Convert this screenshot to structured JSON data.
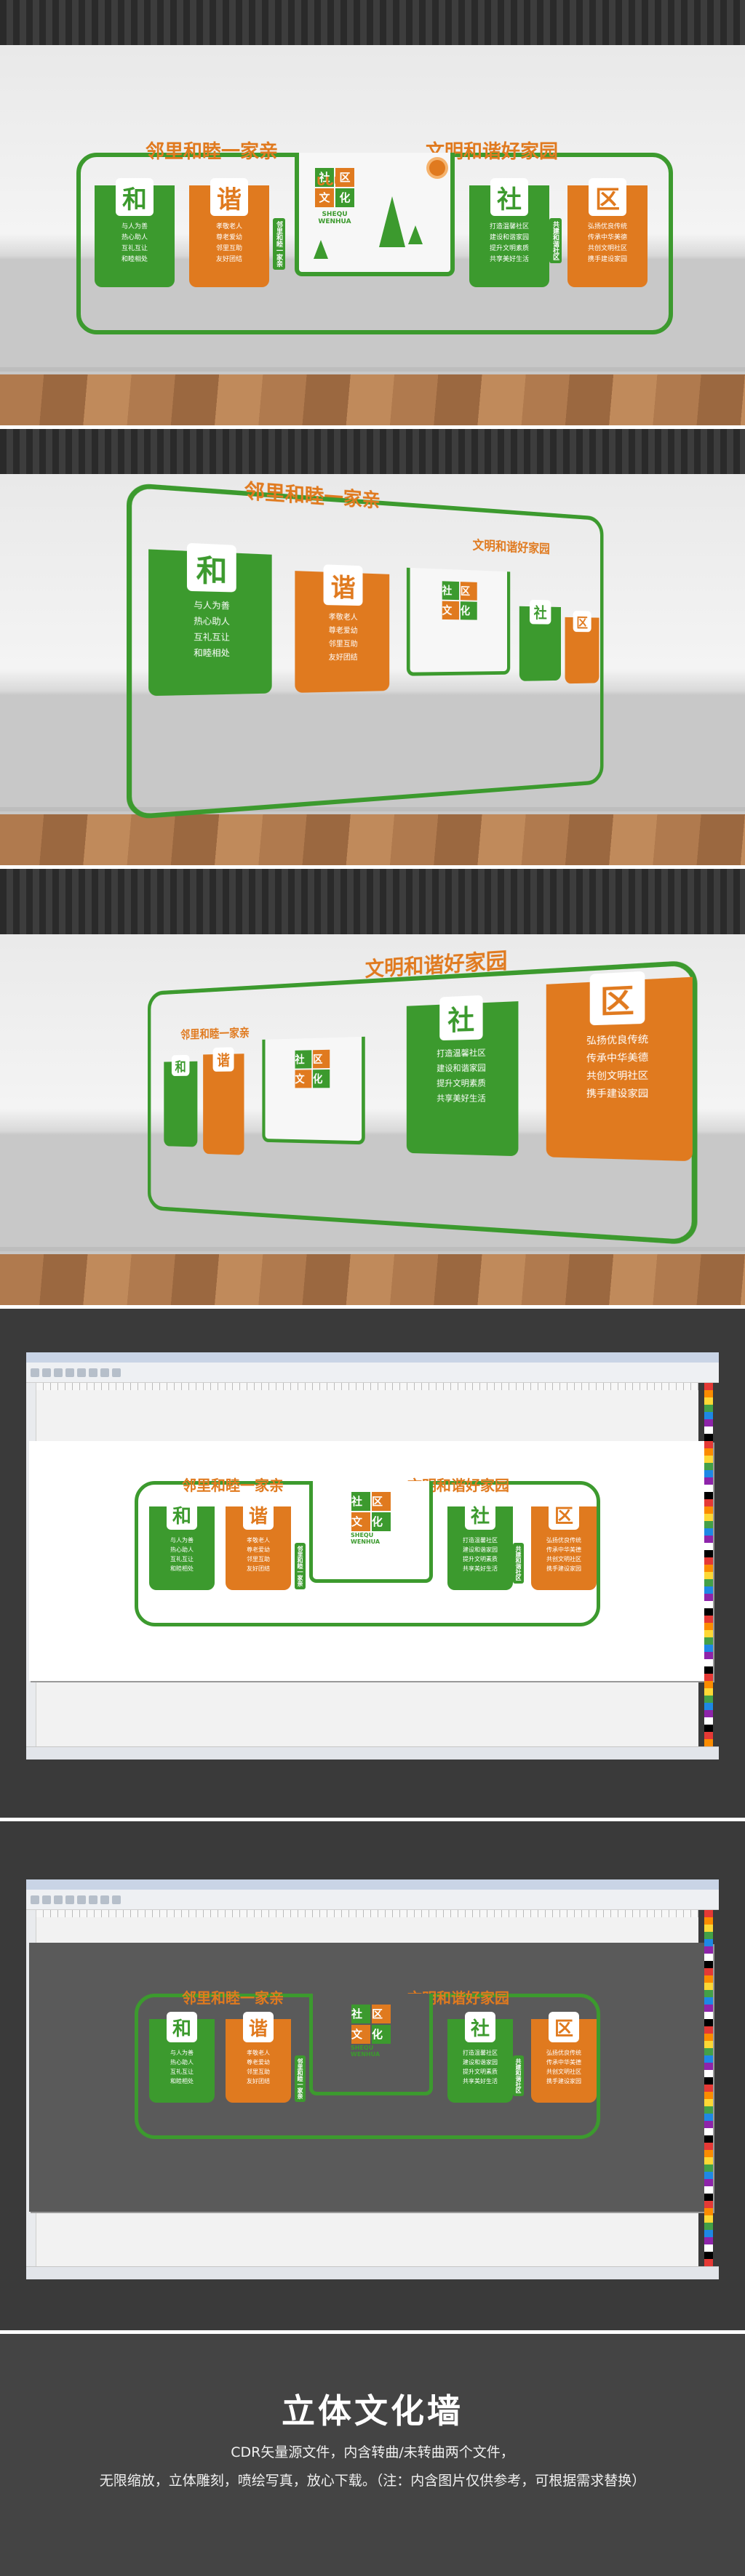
{
  "headline_left": "邻里和睦一家亲",
  "headline_right": "文明和谐好家园",
  "house_chars": [
    "和",
    "谐",
    "社",
    "区"
  ],
  "left_text_1": [
    "与人为善",
    "热心助人",
    "互礼互让",
    "和睦相处"
  ],
  "left_text_2": [
    "孝敬老人",
    "尊老爱幼",
    "邻里互助",
    "友好团结"
  ],
  "right_text_1": [
    "打造温馨社区",
    "建设和谐家园",
    "提升文明素质",
    "共享美好生活"
  ],
  "right_text_2": [
    "弘扬优良传统",
    "传承中华美德",
    "共创文明社区",
    "携手建设家园"
  ],
  "strip_left": "邻里和睦一家亲",
  "strip_right": "共建和谐社区",
  "center_chars": [
    "社",
    "区",
    "文",
    "化"
  ],
  "center_pinyin": [
    "SHEQU",
    "WENHUA"
  ],
  "colors": {
    "green": "#3c9a2e",
    "orange": "#e07a1f"
  },
  "footer_title": "立体文化墙",
  "footer_line_1": "CDR矢量源文件，内含转曲/未转曲两个文件，",
  "footer_line_2": "无限缩放，立体雕刻，喷绘写真，放心下载。（注：内含图片仅供参考，可根据需求替换）"
}
